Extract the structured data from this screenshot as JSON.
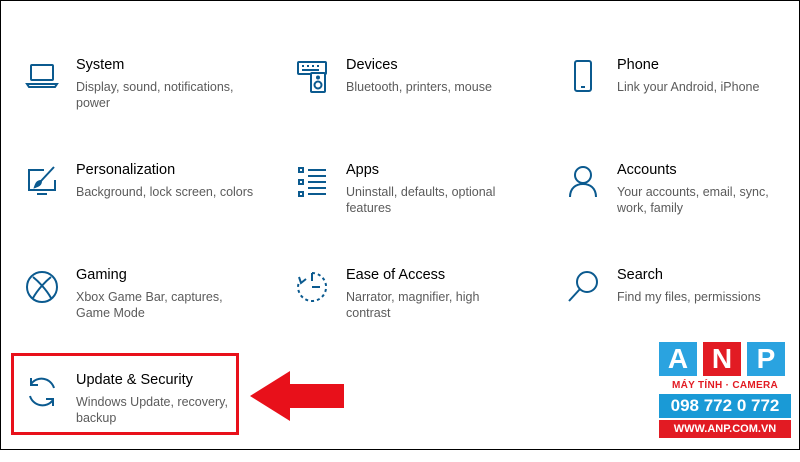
{
  "tiles": [
    {
      "title": "System",
      "desc": "Display, sound, notifications, power",
      "icon": "laptop-icon"
    },
    {
      "title": "Devices",
      "desc": "Bluetooth, printers, mouse",
      "icon": "keyboard-speaker-icon"
    },
    {
      "title": "Phone",
      "desc": "Link your Android, iPhone",
      "icon": "phone-icon"
    },
    {
      "title": "Personalization",
      "desc": "Background, lock screen, colors",
      "icon": "paint-screen-icon"
    },
    {
      "title": "Apps",
      "desc": "Uninstall, defaults, optional features",
      "icon": "app-list-icon"
    },
    {
      "title": "Accounts",
      "desc": "Your accounts, email, sync, work, family",
      "icon": "person-icon"
    },
    {
      "title": "Gaming",
      "desc": "Xbox Game Bar, captures, Game Mode",
      "icon": "xbox-icon"
    },
    {
      "title": "Ease of Access",
      "desc": "Narrator, magnifier, high contrast",
      "icon": "ease-of-access-timer-icon"
    },
    {
      "title": "Search",
      "desc": "Find my files, permissions",
      "icon": "search-icon"
    },
    {
      "title": "Update & Security",
      "desc": "Windows Update, recovery, backup",
      "icon": "sync-arrows-icon"
    }
  ],
  "watermark": {
    "letters": [
      "A",
      "N",
      "P"
    ],
    "tagline": "MÁY TÍNH · CAMERA",
    "phone": "098 772 0 772",
    "url": "WWW.ANP.COM.VN"
  },
  "colors": {
    "icon": "#0b5a8f",
    "highlight": "#e8101a",
    "logo_blue": "#2aa3e0",
    "logo_red": "#e21b23"
  }
}
